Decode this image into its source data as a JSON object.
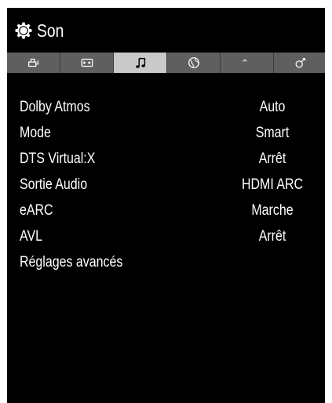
{
  "header": {
    "title": "Son",
    "icon": "gear-icon"
  },
  "tabs": [
    {
      "icon": "picture-icon",
      "active": false
    },
    {
      "icon": "input-icon",
      "active": false
    },
    {
      "icon": "music-note-icon",
      "active": true
    },
    {
      "icon": "globe-icon",
      "active": false
    },
    {
      "icon": "satellite-dish-icon",
      "active": false
    },
    {
      "icon": "settings-wrench-icon",
      "active": false
    }
  ],
  "settings": [
    {
      "label": "Dolby Atmos",
      "value": "Auto"
    },
    {
      "label": "Mode",
      "value": "Smart"
    },
    {
      "label": "DTS Virtual:X",
      "value": "Arrêt"
    },
    {
      "label": "Sortie Audio",
      "value": "HDMI ARC"
    },
    {
      "label": "eARC",
      "value": "Marche"
    },
    {
      "label": "AVL",
      "value": "Arrêt"
    },
    {
      "label": "Réglages avancés",
      "value": ""
    }
  ],
  "colors": {
    "background": "#000000",
    "tab_bar": "#5f5f5f",
    "tab_active": "#c9c9c9",
    "text": "#ffffff"
  }
}
